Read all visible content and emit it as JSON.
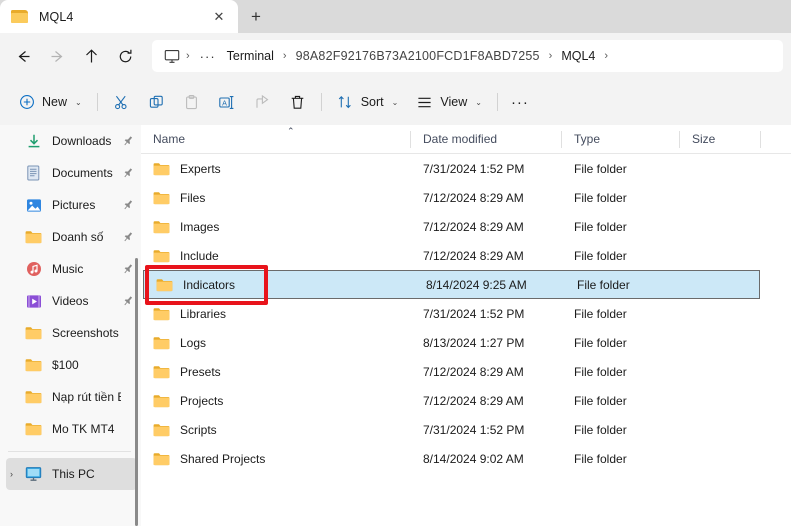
{
  "window": {
    "tab": {
      "title": "MQL4",
      "close_label": "✕",
      "icon": "folder-icon"
    },
    "new_tab_label": "+"
  },
  "nav": {
    "back": "←",
    "forward": "→",
    "up": "↑",
    "refresh": "⟳"
  },
  "address": {
    "root_icon": "monitor-icon",
    "overflow": "···",
    "crumbs": [
      {
        "label": "Terminal"
      },
      {
        "label": "98A82F92176B73A2100FCD1F8ABD7255"
      },
      {
        "label": "MQL4"
      }
    ],
    "separator": "›"
  },
  "toolbar": {
    "new_label": "New",
    "sort_label": "Sort",
    "view_label": "View",
    "more_label": "···",
    "cut_icon": "scissors-icon",
    "copy_icon": "copy-icon",
    "paste_icon": "paste-icon",
    "rename_icon": "rename-icon",
    "share_icon": "share-icon",
    "delete_icon": "trash-icon",
    "chevron": "⌄"
  },
  "sidebar": {
    "items": [
      {
        "label": "Downloads",
        "icon": "download-icon",
        "pinned": true
      },
      {
        "label": "Documents",
        "icon": "document-icon",
        "pinned": true
      },
      {
        "label": "Pictures",
        "icon": "pictures-icon",
        "pinned": true
      },
      {
        "label": "Doanh số",
        "icon": "folder-icon",
        "pinned": true
      },
      {
        "label": "Music",
        "icon": "music-icon",
        "pinned": true
      },
      {
        "label": "Videos",
        "icon": "video-icon",
        "pinned": true
      },
      {
        "label": "Screenshots",
        "icon": "folder-icon",
        "pinned": false
      },
      {
        "label": "$100",
        "icon": "folder-icon",
        "pinned": false
      },
      {
        "label": "Nạp rút tiền Exn",
        "icon": "folder-icon",
        "pinned": false
      },
      {
        "label": "Mo TK MT4",
        "icon": "folder-icon",
        "pinned": false
      }
    ],
    "this_pc": {
      "label": "This PC",
      "icon": "computer-icon",
      "expander": "›",
      "selected": true
    }
  },
  "filelist": {
    "columns": [
      {
        "key": "name",
        "label": "Name",
        "sorted": "asc"
      },
      {
        "key": "date",
        "label": "Date modified",
        "sorted": ""
      },
      {
        "key": "type",
        "label": "Type",
        "sorted": ""
      },
      {
        "key": "size",
        "label": "Size",
        "sorted": ""
      }
    ],
    "sort_indicator": "⌃",
    "rows": [
      {
        "name": "Experts",
        "date": "7/31/2024 1:52 PM",
        "type": "File folder",
        "size": "",
        "selected": false
      },
      {
        "name": "Files",
        "date": "7/12/2024 8:29 AM",
        "type": "File folder",
        "size": "",
        "selected": false
      },
      {
        "name": "Images",
        "date": "7/12/2024 8:29 AM",
        "type": "File folder",
        "size": "",
        "selected": false
      },
      {
        "name": "Include",
        "date": "7/12/2024 8:29 AM",
        "type": "File folder",
        "size": "",
        "selected": false
      },
      {
        "name": "Indicators",
        "date": "8/14/2024 9:25 AM",
        "type": "File folder",
        "size": "",
        "selected": true
      },
      {
        "name": "Libraries",
        "date": "7/31/2024 1:52 PM",
        "type": "File folder",
        "size": "",
        "selected": false
      },
      {
        "name": "Logs",
        "date": "8/13/2024 1:27 PM",
        "type": "File folder",
        "size": "",
        "selected": false
      },
      {
        "name": "Presets",
        "date": "7/12/2024 8:29 AM",
        "type": "File folder",
        "size": "",
        "selected": false
      },
      {
        "name": "Projects",
        "date": "7/12/2024 8:29 AM",
        "type": "File folder",
        "size": "",
        "selected": false
      },
      {
        "name": "Scripts",
        "date": "7/31/2024 1:52 PM",
        "type": "File folder",
        "size": "",
        "selected": false
      },
      {
        "name": "Shared Projects",
        "date": "8/14/2024 9:02 AM",
        "type": "File folder",
        "size": "",
        "selected": false
      }
    ]
  },
  "annotation": {
    "target": "Indicators",
    "color": "#e8131b"
  },
  "colors": {
    "selection": "#cce8f7",
    "accent": "#0078d4",
    "chrome": "#f3f3f3",
    "tabstrip": "#dadada",
    "folder": "#ffcc66"
  }
}
